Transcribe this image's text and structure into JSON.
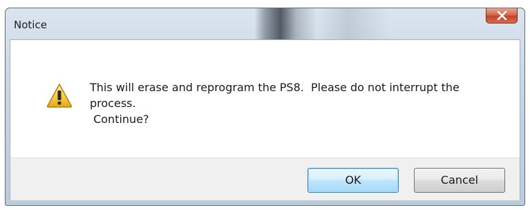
{
  "window": {
    "title": "Notice",
    "close_icon": "close-icon"
  },
  "message": {
    "icon": "warning-icon",
    "lines": [
      "This will erase and reprogram the PS8.  Please do not interrupt the",
      "process.",
      " Continue?"
    ]
  },
  "buttons": {
    "ok_label": "OK",
    "cancel_label": "Cancel"
  },
  "colors": {
    "close_button": "#c4432a",
    "default_button_border": "#3c7fb1",
    "footer_background": "#f0f0f0"
  }
}
